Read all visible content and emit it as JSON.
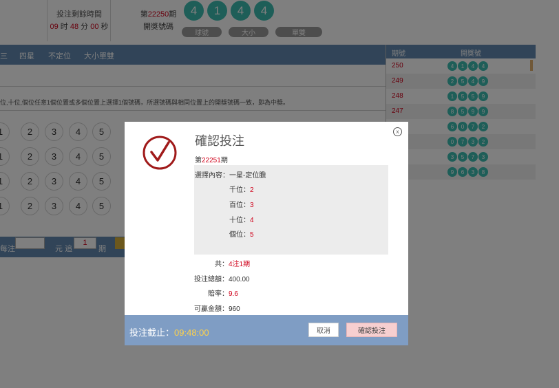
{
  "header": {
    "timer_label": "投注剩餘時間",
    "timer": {
      "hours": "09",
      "hours_unit": "时",
      "minutes": "48",
      "minutes_unit": "分",
      "seconds": "00",
      "seconds_unit": "秒"
    },
    "issue_prefix": "第",
    "issue_number": "22250",
    "issue_suffix": "期",
    "draw_label": "開獎號碼",
    "draw_numbers": [
      "4",
      "1",
      "4",
      "4"
    ],
    "tabs": [
      "球號",
      "大小",
      "單雙"
    ]
  },
  "play_tabs": [
    "三",
    "四星",
    "不定位",
    "大小單雙"
  ],
  "description": "位,十位,個位任意1個位置或多個位置上選擇1個號碼，所選號碼與相同位置上的開獎號碼一致，即為中獎。",
  "number_rows": [
    [
      "1",
      "2",
      "3",
      "4",
      "5"
    ],
    [
      "1",
      "2",
      "3",
      "4",
      "5"
    ],
    [
      "1",
      "2",
      "3",
      "4",
      "5"
    ],
    [
      "1",
      "2",
      "3",
      "4",
      "5"
    ]
  ],
  "bet_bar": {
    "per_bet_label": "每注",
    "yuan_label": "元",
    "chase_label": "追",
    "chase_value": "1",
    "issue_label": "期"
  },
  "history": {
    "col_issue": "期號",
    "col_numbers": "開獎號",
    "rows": [
      {
        "issue": "250",
        "numbers": [
          "4",
          "1",
          "4",
          "4"
        ]
      },
      {
        "issue": "249",
        "numbers": [
          "2",
          "5",
          "4",
          "9"
        ]
      },
      {
        "issue": "248",
        "numbers": [
          "1",
          "5",
          "5",
          "9"
        ]
      },
      {
        "issue": "247",
        "numbers": [
          "8",
          "5",
          "9",
          "9"
        ]
      },
      {
        "issue": "",
        "numbers": [
          "6",
          "0",
          "7",
          "2"
        ]
      },
      {
        "issue": "",
        "numbers": [
          "0",
          "7",
          "3",
          "2"
        ]
      },
      {
        "issue": "",
        "numbers": [
          "3",
          "5",
          "7",
          "3"
        ]
      },
      {
        "issue": "",
        "numbers": [
          "9",
          "6",
          "3",
          "8"
        ]
      }
    ]
  },
  "modal": {
    "title": "確認投注",
    "issue_prefix": "第",
    "issue_number": "22251",
    "issue_suffix": "期",
    "selection_label": "選擇內容：",
    "selection_value": "一星-定位膽",
    "positions": [
      {
        "label": "千位：",
        "value": "2"
      },
      {
        "label": "百位：",
        "value": "3"
      },
      {
        "label": "十位：",
        "value": "4"
      },
      {
        "label": "個位：",
        "value": "5"
      }
    ],
    "total_label": "共：",
    "total_value": "4注1期",
    "amount_label": "投注總額：",
    "amount_value": "400.00",
    "odds_label": "賠率：",
    "odds_value": "9.6",
    "win_label": "可贏金額：",
    "win_value": "960",
    "deadline_label": "投注截止：",
    "deadline_time": "09:48:00",
    "cancel_label": "取消",
    "confirm_label": "確認投注",
    "close_symbol": "x",
    "colors": {
      "accent_red": "#d0021b",
      "ball_teal": "#3dbdb1",
      "bar_blue": "#6289b0",
      "footer_blue": "#7f9dc4",
      "deadline_yellow": "#ffd24a"
    }
  }
}
